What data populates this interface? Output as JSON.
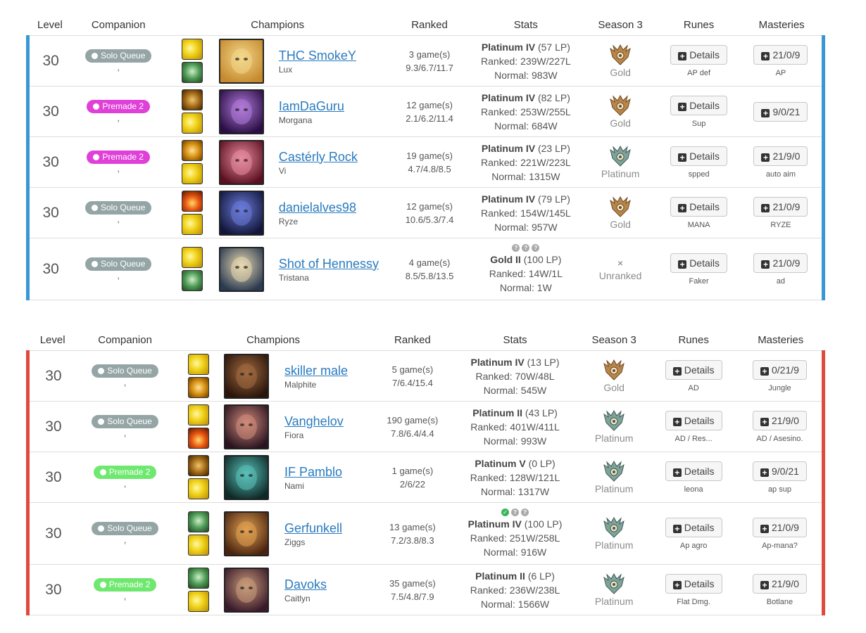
{
  "headers": {
    "level": "Level",
    "companion": "Companion",
    "champions": "Champions",
    "ranked": "Ranked",
    "stats": "Stats",
    "season": "Season 3",
    "runes": "Runes",
    "masteries": "Masteries"
  },
  "colors": {
    "blue_team": "#3a97d6",
    "red_team": "#e04a3c",
    "solo_queue": "#95a5a6",
    "premade_magenta": "#e040d8",
    "premade_green": "#6fe86f",
    "link": "#2a7bbf"
  },
  "teams": [
    {
      "side": "blue",
      "players": [
        {
          "level": "30",
          "queue": "Solo Queue",
          "queue_type": "solo",
          "queue_icon": "user-icon",
          "companion_sub": ",",
          "spells": [
            "flash",
            "ghost"
          ],
          "summoner": "THC SmokeY",
          "champion": "Lux",
          "games": "3 game(s)",
          "kda": "9.3/6.7/11.7",
          "tier_name": "Platinum IV",
          "lp": "(57 LP)",
          "ranked": "Ranked: 239W/227L",
          "normal": "Normal: 983W",
          "season_tier": "Gold",
          "rune_label": "Details",
          "rune_page": "AP def",
          "mastery": "21/0/9",
          "mastery_page": "AP",
          "verify": null
        },
        {
          "level": "30",
          "queue": "Premade 2",
          "queue_type": "premade_magenta",
          "queue_icon": "gear-icon",
          "companion_sub": ",",
          "spells": [
            "teleport",
            "flash"
          ],
          "summoner": "IamDaGuru",
          "champion": "Morgana",
          "games": "12 game(s)",
          "kda": "2.1/6.2/11.4",
          "tier_name": "Platinum IV",
          "lp": "(82 LP)",
          "ranked": "Ranked: 253W/255L",
          "normal": "Normal: 684W",
          "season_tier": "Gold",
          "rune_label": "Details",
          "rune_page": "Sup",
          "mastery": "9/0/21",
          "mastery_page": "",
          "verify": null
        },
        {
          "level": "30",
          "queue": "Premade 2",
          "queue_type": "premade_magenta",
          "queue_icon": "group-icon",
          "companion_sub": ",",
          "spells": [
            "exhaust",
            "flash"
          ],
          "summoner": "Castérly Rock",
          "champion": "Vi",
          "games": "19 game(s)",
          "kda": "4.7/4.8/8.5",
          "tier_name": "Platinum IV",
          "lp": "(23 LP)",
          "ranked": "Ranked: 221W/223L",
          "normal": "Normal: 1315W",
          "season_tier": "Platinum",
          "rune_label": "Details",
          "rune_page": "spped",
          "mastery": "21/9/0",
          "mastery_page": "auto aim",
          "verify": null
        },
        {
          "level": "30",
          "queue": "Solo Queue",
          "queue_type": "solo",
          "queue_icon": "user-icon",
          "companion_sub": ",",
          "spells": [
            "ignite",
            "flash"
          ],
          "summoner": "danielalves98",
          "champion": "Ryze",
          "games": "12 game(s)",
          "kda": "10.6/5.3/7.4",
          "tier_name": "Platinum IV",
          "lp": "(79 LP)",
          "ranked": "Ranked: 154W/145L",
          "normal": "Normal: 957W",
          "season_tier": "Gold",
          "rune_label": "Details",
          "rune_page": "MANA",
          "mastery": "21/0/9",
          "mastery_page": "RYZE",
          "verify": null
        },
        {
          "level": "30",
          "queue": "Solo Queue",
          "queue_type": "solo",
          "queue_icon": "user-icon",
          "companion_sub": ",",
          "spells": [
            "flash",
            "ghost"
          ],
          "summoner": "Shot of Hennessy",
          "champion": "Tristana",
          "games": "4 game(s)",
          "kda": "8.5/5.8/13.5",
          "tier_name": "Gold II",
          "lp": "(100 LP)",
          "ranked": "Ranked: 14W/1L",
          "normal": "Normal: 1W",
          "season_tier": "Unranked",
          "rune_label": "Details",
          "rune_page": "Faker",
          "mastery": "21/0/9",
          "mastery_page": "ad",
          "verify": [
            "?",
            "?",
            "?"
          ]
        }
      ]
    },
    {
      "side": "red",
      "players": [
        {
          "level": "30",
          "queue": "Solo Queue",
          "queue_type": "solo",
          "queue_icon": "user-icon",
          "companion_sub": ",",
          "spells": [
            "flash",
            "exhaust"
          ],
          "summoner": "skiller male",
          "champion": "Malphite",
          "games": "5 game(s)",
          "kda": "7/6.4/15.4",
          "tier_name": "Platinum IV",
          "lp": "(13 LP)",
          "ranked": "Ranked: 70W/48L",
          "normal": "Normal: 545W",
          "season_tier": "Gold",
          "rune_label": "Details",
          "rune_page": "AD",
          "mastery": "0/21/9",
          "mastery_page": "Jungle",
          "verify": null
        },
        {
          "level": "30",
          "queue": "Solo Queue",
          "queue_type": "solo",
          "queue_icon": "user-icon",
          "companion_sub": ",",
          "spells": [
            "flash",
            "ignite"
          ],
          "summoner": "Vanghelov",
          "champion": "Fiora",
          "games": "190 game(s)",
          "kda": "7.8/6.4/4.4",
          "tier_name": "Platinum II",
          "lp": "(43 LP)",
          "ranked": "Ranked: 401W/411L",
          "normal": "Normal: 993W",
          "season_tier": "Platinum",
          "rune_label": "Details",
          "rune_page": "AD / Res...",
          "mastery": "21/9/0",
          "mastery_page": "AD / Asesino.",
          "verify": null
        },
        {
          "level": "30",
          "queue": "Premade 2",
          "queue_type": "premade_green",
          "queue_icon": "gear-icon",
          "companion_sub": ",",
          "spells": [
            "teleport",
            "flash"
          ],
          "summoner": "IF Pamblo",
          "champion": "Nami",
          "games": "1 game(s)",
          "kda": "2/6/22",
          "tier_name": "Platinum V",
          "lp": "(0 LP)",
          "ranked": "Ranked: 128W/121L",
          "normal": "Normal: 1317W",
          "season_tier": "Platinum",
          "rune_label": "Details",
          "rune_page": "leona",
          "mastery": "9/0/21",
          "mastery_page": "ap sup",
          "verify": null
        },
        {
          "level": "30",
          "queue": "Solo Queue",
          "queue_type": "solo",
          "queue_icon": "user-icon",
          "companion_sub": ",",
          "spells": [
            "ghost",
            "flash"
          ],
          "summoner": "Gerfunkell",
          "champion": "Ziggs",
          "games": "13 game(s)",
          "kda": "7.2/3.8/8.3",
          "tier_name": "Platinum IV",
          "lp": "(100 LP)",
          "ranked": "Ranked: 251W/258L",
          "normal": "Normal: 916W",
          "season_tier": "Platinum",
          "rune_label": "Details",
          "rune_page": "Ap agro",
          "mastery": "21/0/9",
          "mastery_page": "Ap-mana?",
          "verify": [
            "✓",
            "?",
            "?"
          ]
        },
        {
          "level": "30",
          "queue": "Premade 2",
          "queue_type": "premade_green",
          "queue_icon": "group-icon",
          "companion_sub": ",",
          "spells": [
            "ghost",
            "flash"
          ],
          "summoner": "Davoks",
          "champion": "Caitlyn",
          "games": "35 game(s)",
          "kda": "7.5/4.8/7.9",
          "tier_name": "Platinum II",
          "lp": "(6 LP)",
          "ranked": "Ranked: 236W/238L",
          "normal": "Normal: 1566W",
          "season_tier": "Platinum",
          "rune_label": "Details",
          "rune_page": "Flat Dmg.",
          "mastery": "21/9/0",
          "mastery_page": "Botlane",
          "verify": null
        }
      ]
    }
  ],
  "champion_colors": {
    "Lux": [
      "#f3d78a",
      "#c58a2e"
    ],
    "Morgana": [
      "#b07ad8",
      "#2a0e45"
    ],
    "Vi": [
      "#e88aa0",
      "#5a1020"
    ],
    "Ryze": [
      "#6a7ad8",
      "#12163a"
    ],
    "Tristana": [
      "#e8d8b0",
      "#2a3a52"
    ],
    "Malphite": [
      "#a06a40",
      "#2a140a"
    ],
    "Fiora": [
      "#d08a7a",
      "#2a1420"
    ],
    "Nami": [
      "#5ac0b8",
      "#0e2a28"
    ],
    "Ziggs": [
      "#e0a050",
      "#4a2410"
    ],
    "Caitlyn": [
      "#c89a7a",
      "#3a1a2a"
    ]
  }
}
